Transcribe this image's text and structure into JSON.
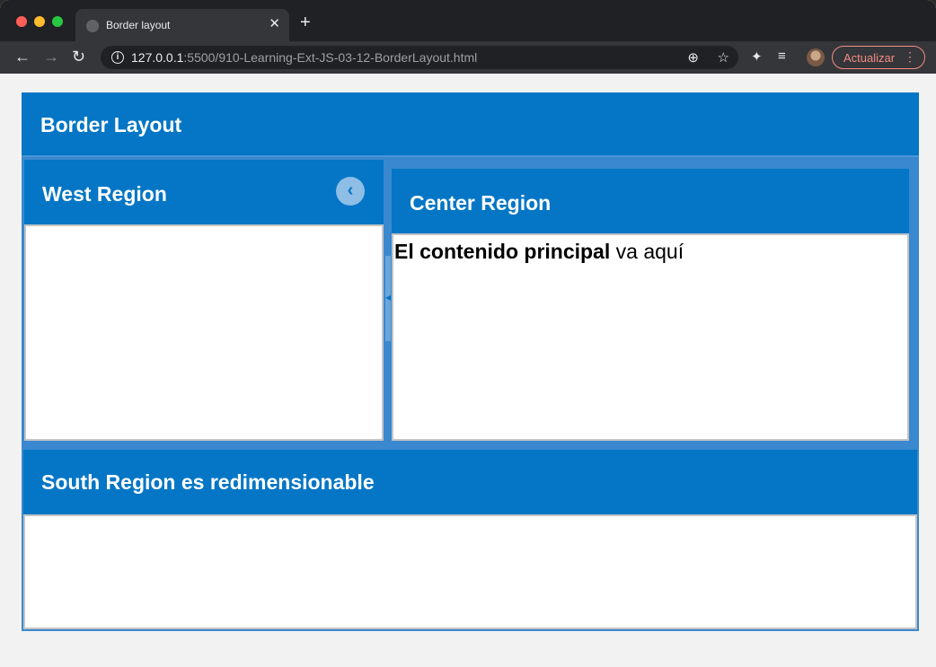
{
  "browser": {
    "tab_title": "Border layout",
    "tab_close": "✕",
    "new_tab": "+",
    "url_host": "127.0.0.1",
    "url_rest": ":5500/910-Learning-Ext-JS-03-12-BorderLayout.html",
    "update_label": "Actualizar",
    "icons": {
      "back": "←",
      "forward": "→",
      "reload": "↻",
      "info": "i",
      "zoom": "⊕",
      "star": "☆",
      "extensions": "✦",
      "media": "≡",
      "menu": "⋮"
    }
  },
  "app": {
    "title": "Border Layout",
    "west": {
      "title": "West Region",
      "collapse_icon": "‹"
    },
    "splitter_icon": "◂",
    "center": {
      "title": "Center Region",
      "content_strong": "El contenido principal",
      "content_rest": " va aquí"
    },
    "south": {
      "title": "South Region es redimensionable"
    }
  },
  "colors": {
    "header_blue": "#0476c5",
    "body_blue": "#3a88cf",
    "update_red": "#f28b82"
  }
}
